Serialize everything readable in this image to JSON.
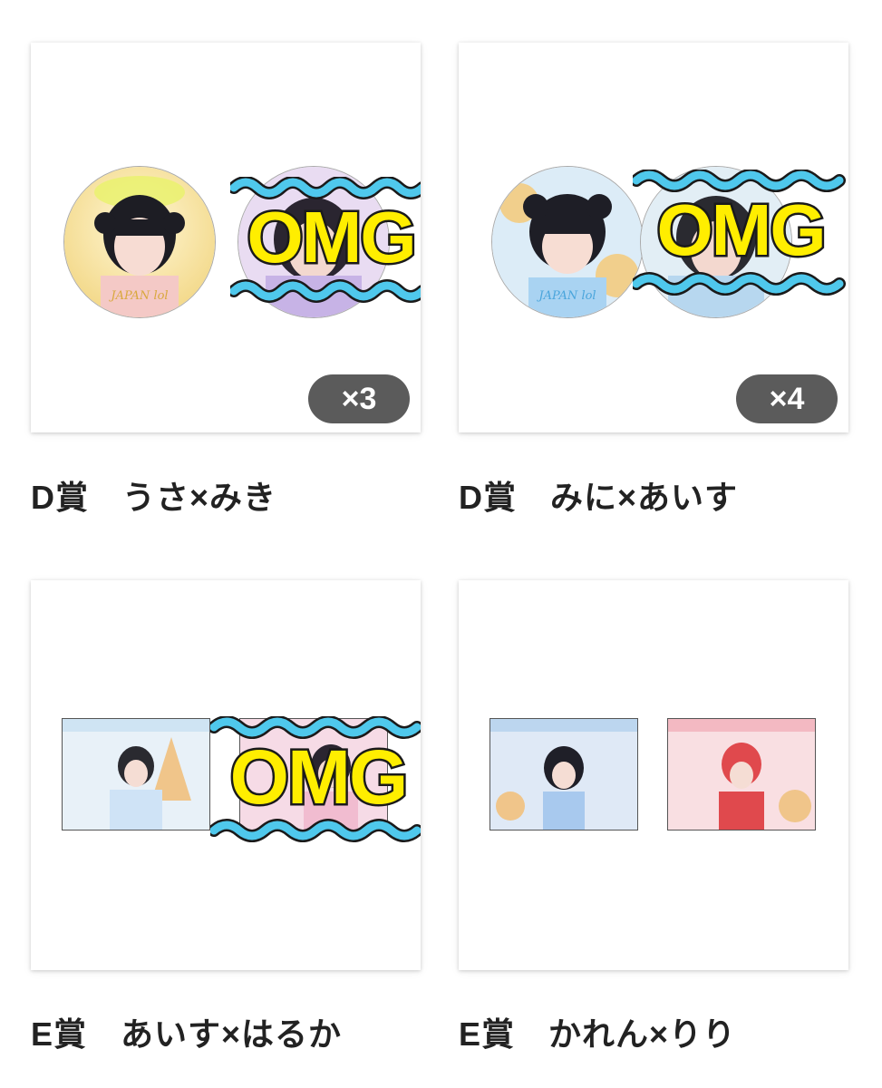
{
  "colors": {
    "label_text": "#222222",
    "badge_bg": "#5b5b5b",
    "badge_text": "#ffffff",
    "omg_fill": "#ffee00",
    "omg_outline": "#1a1a1a",
    "omg_wave": "#4fc8ec"
  },
  "cards": [
    {
      "label": "D賞　うさ×みき",
      "badge": "×3",
      "omg_text": "OMG"
    },
    {
      "label": "D賞　みに×あいす",
      "badge": "×4",
      "omg_text": "OMG"
    },
    {
      "label": "E賞　あいす×はるか",
      "omg_text": "OMG"
    },
    {
      "label": "E賞　かれん×りり"
    }
  ]
}
